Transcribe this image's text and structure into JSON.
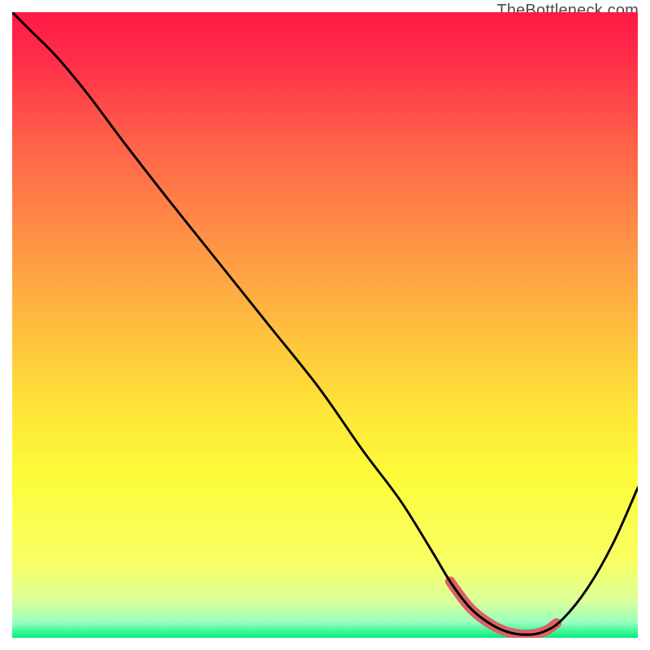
{
  "watermark": "TheBottleneck.com",
  "colors": {
    "gradient": [
      {
        "stop": 0.0,
        "color": "#ff1946"
      },
      {
        "stop": 0.08,
        "color": "#ff2f48"
      },
      {
        "stop": 0.2,
        "color": "#ff5e49"
      },
      {
        "stop": 0.35,
        "color": "#ff8e47"
      },
      {
        "stop": 0.5,
        "color": "#ffbd3f"
      },
      {
        "stop": 0.63,
        "color": "#ffe339"
      },
      {
        "stop": 0.74,
        "color": "#fdfb39"
      },
      {
        "stop": 0.88,
        "color": "#f8ff64"
      },
      {
        "stop": 0.94,
        "color": "#dcff99"
      },
      {
        "stop": 0.975,
        "color": "#9bffbf"
      },
      {
        "stop": 1.0,
        "color": "#00ef7c"
      }
    ],
    "curve_stroke": "#000000",
    "thick_segment_stroke": "#da6264"
  },
  "chart_data": {
    "type": "line",
    "title": "",
    "xlabel": "",
    "ylabel": "",
    "xlim": [
      0,
      100
    ],
    "ylim": [
      0,
      100
    ],
    "series": [
      {
        "name": "bottleneck-curve",
        "x": [
          0,
          3,
          7,
          12,
          18,
          25,
          33,
          41,
          49,
          56,
          62,
          67,
          70,
          73,
          76,
          79,
          82,
          85,
          88,
          92,
          96,
          100
        ],
        "y": [
          100,
          97,
          93,
          87,
          79,
          70,
          60,
          50,
          40,
          30,
          22,
          14,
          9,
          5,
          2.5,
          1,
          0.5,
          1,
          3,
          8,
          15,
          24
        ]
      }
    ],
    "thick_segment": {
      "x_start": 70,
      "x_end": 87
    }
  }
}
